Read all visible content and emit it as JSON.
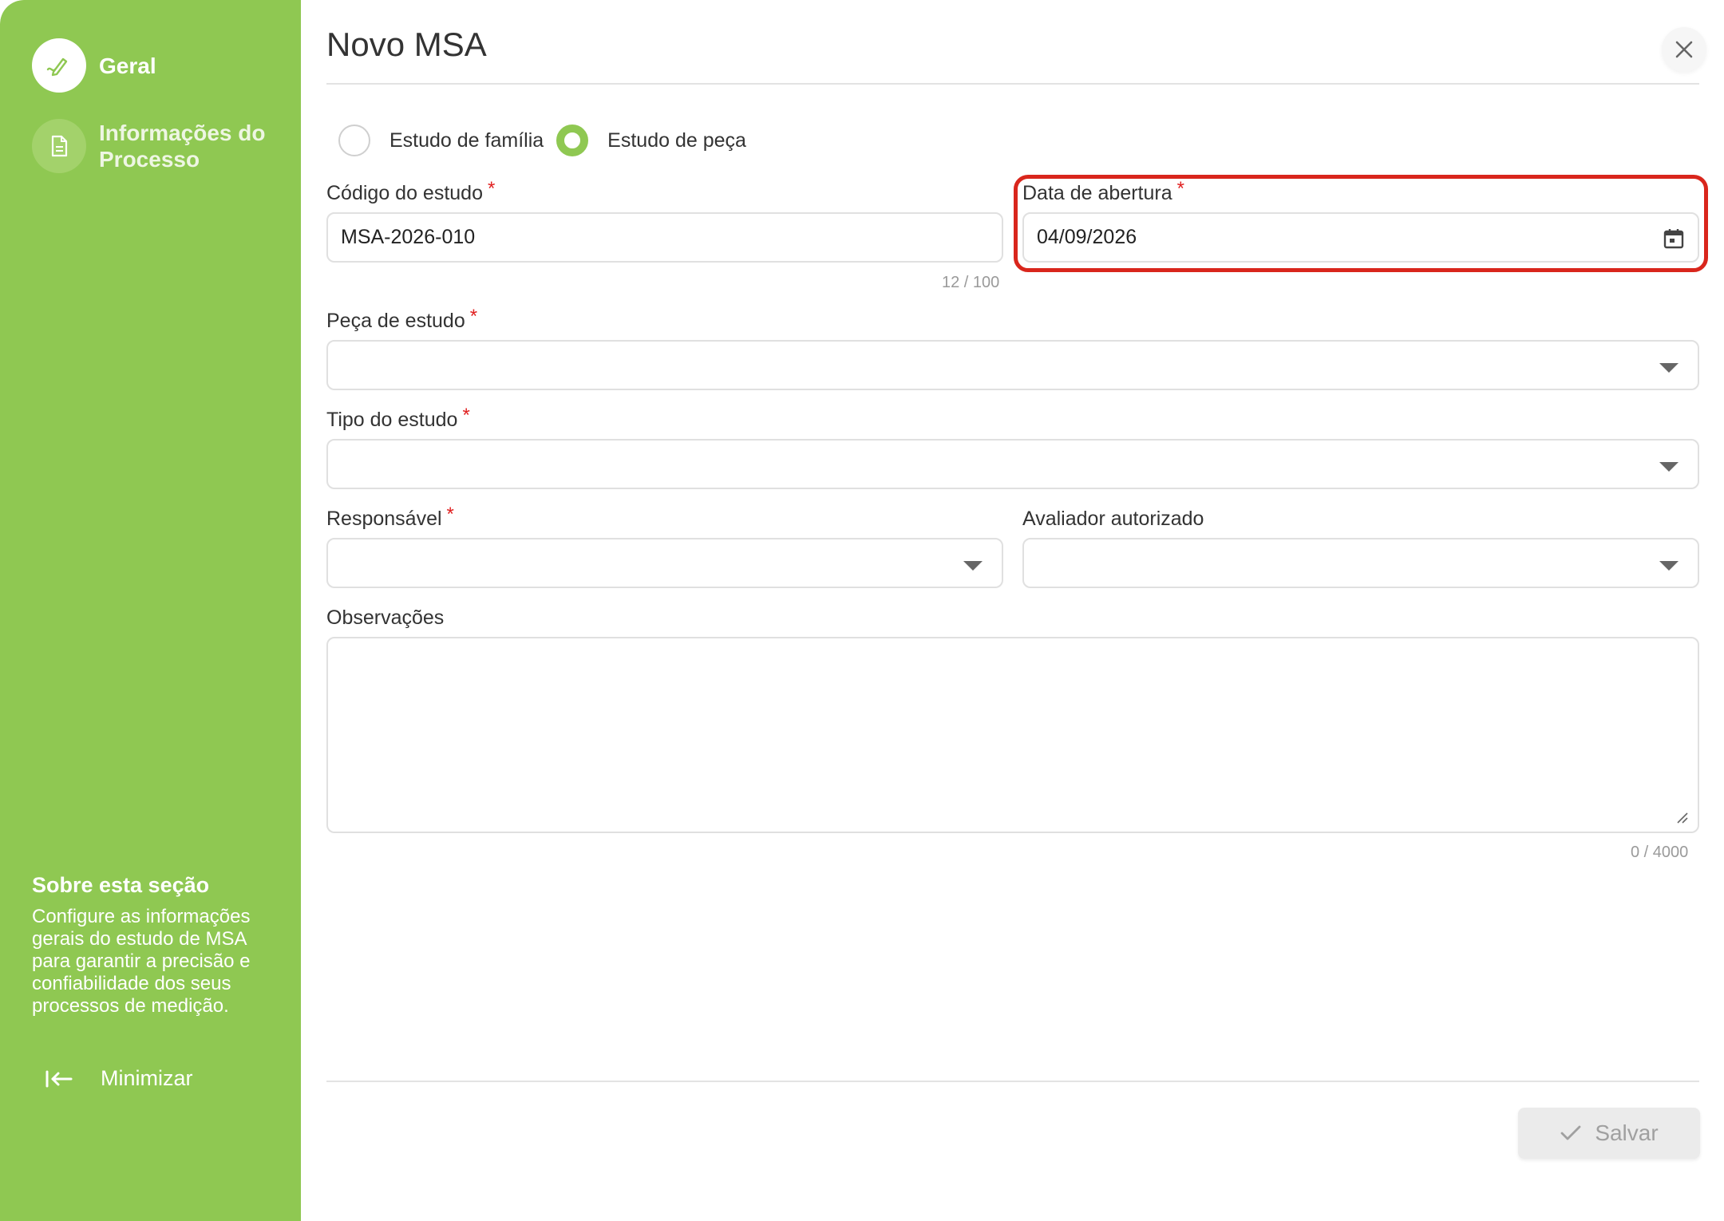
{
  "sidebar": {
    "items": [
      {
        "label": "Geral",
        "icon": "pencil-icon",
        "active": true
      },
      {
        "label": "Informações do Processo",
        "icon": "document-icon",
        "active": false
      }
    ],
    "about_title": "Sobre esta seção",
    "about_text": "Configure as informações gerais do estudo de MSA para garantir a precisão e confiabilidade dos seus processos de medição.",
    "minimize_label": "Minimizar"
  },
  "header": {
    "title": "Novo MSA"
  },
  "form": {
    "study_type": {
      "options": [
        "Estudo de família",
        "Estudo de peça"
      ],
      "selected": "Estudo de peça"
    },
    "codigo": {
      "label": "Código do estudo",
      "value": "MSA-2026-010",
      "counter": "12 / 100"
    },
    "data_abertura": {
      "label": "Data de abertura",
      "value": "04/09/2026"
    },
    "peca": {
      "label": "Peça de estudo",
      "value": ""
    },
    "tipo": {
      "label": "Tipo do estudo",
      "value": ""
    },
    "responsavel": {
      "label": "Responsável",
      "value": ""
    },
    "avaliador": {
      "label": "Avaliador autorizado",
      "value": ""
    },
    "observacoes": {
      "label": "Observações",
      "value": "",
      "counter": "0 / 4000"
    },
    "required_mark": "*"
  },
  "footer": {
    "save_label": "Salvar"
  },
  "colors": {
    "sidebar": "#8fc852",
    "accent": "#8fc852",
    "required": "#e02020",
    "highlight": "#d9261c"
  }
}
